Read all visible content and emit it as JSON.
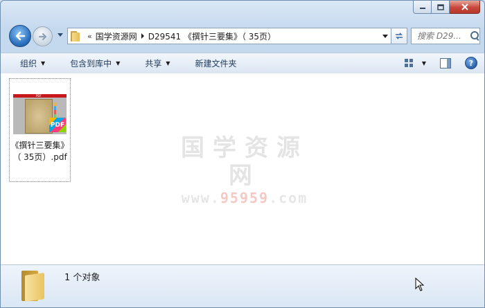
{
  "window": {
    "caption_buttons": [
      "minimize",
      "maximize",
      "close"
    ]
  },
  "address_bar": {
    "overflow": "«",
    "crumbs": [
      "国学资源网",
      "D29541 《撰针三要集》（ 35页）"
    ]
  },
  "search": {
    "placeholder": "搜索 D29..."
  },
  "toolbar": {
    "organize": "组织",
    "include_in_library": "包含到库中",
    "share": "共享",
    "new_folder": "新建文件夹"
  },
  "file": {
    "name": "《撰针三要集》（ 35页）.pdf",
    "thumb_badge": "PDF",
    "thumb_label": "PDF"
  },
  "watermark": {
    "text": "国学资源网",
    "url_prefix": "www.",
    "url_highlight": "95959",
    "url_suffix": ".com"
  },
  "details": {
    "count": "1 个对象"
  },
  "colors": {
    "accent_blue": "#2a6fbd",
    "close_red": "#c9473a",
    "command_text": "#1e395b"
  }
}
